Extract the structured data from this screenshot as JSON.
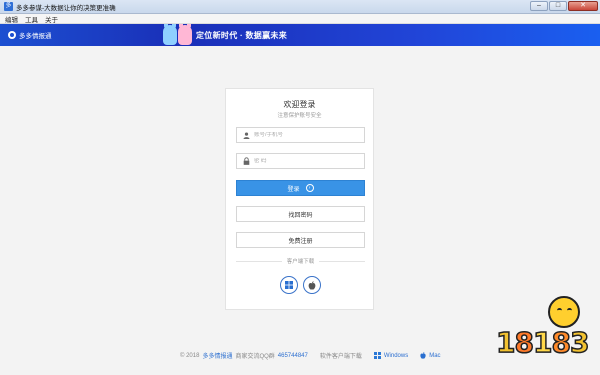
{
  "window": {
    "title": "多多参谋-大数据让你的决策更准确",
    "minimize": "–",
    "maximize": "□",
    "close": "✕"
  },
  "menu": {
    "items": [
      "编辑",
      "工具",
      "关于"
    ]
  },
  "banner": {
    "brand": "多多情报通",
    "slogan": "定位新时代 · 数据赢未来"
  },
  "login": {
    "title": "欢迎登录",
    "subtitle": "注意保护账号安全",
    "account_placeholder": "账号/手机号",
    "password_placeholder": "密 码",
    "login_button": "登录",
    "forgot_button": "找回密码",
    "register_button": "免费注册",
    "download_label": "客户端下载"
  },
  "footer": {
    "copyright": "© 2018",
    "brand": "多多情报通",
    "qq_label": "商家交流QQ群",
    "qq_number": "465744847",
    "download_label": "软件客户端下载",
    "windows": "Windows",
    "mac": "Mac"
  },
  "watermark": {
    "text": "18183"
  },
  "colors": {
    "accent": "#3993e6",
    "banner": "#1c4fd1",
    "link": "#2c6fd0"
  },
  "icons": {
    "app": "app-icon",
    "user": "user-icon",
    "lock": "lock-icon",
    "arrow": "arrow-right-circle-icon",
    "windows": "windows-icon",
    "apple": "apple-icon"
  }
}
